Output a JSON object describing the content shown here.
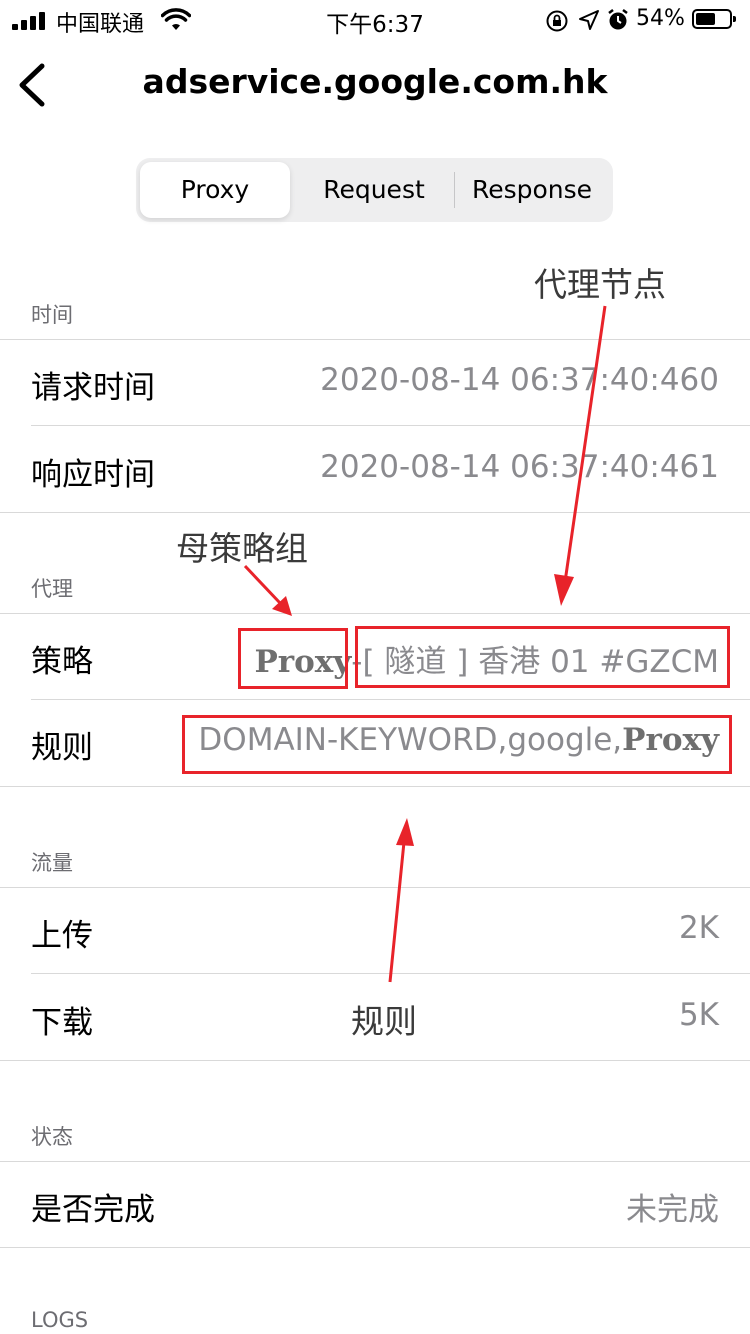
{
  "status_bar": {
    "carrier": "中国联通",
    "time": "下午6:37",
    "battery": "54%"
  },
  "nav": {
    "title": "adservice.google.com.hk"
  },
  "tabs": [
    {
      "label": "Proxy",
      "active": true
    },
    {
      "label": "Request",
      "active": false
    },
    {
      "label": "Response",
      "active": false
    }
  ],
  "sections": {
    "time": {
      "header": "时间",
      "rows": [
        {
          "label": "请求时间",
          "value": "2020-08-14 06:37:40:460"
        },
        {
          "label": "响应时间",
          "value": "2020-08-14 06:37:40:461"
        }
      ]
    },
    "proxy": {
      "header": "代理",
      "policy_label": "策略",
      "policy_group": "Proxy",
      "policy_separator": "-",
      "policy_node": "[ 隧道 ] 香港 01 #GZCM",
      "rule_label": "规则",
      "rule_text": "DOMAIN-KEYWORD,google,",
      "rule_policy": "Proxy"
    },
    "traffic": {
      "header": "流量",
      "rows": [
        {
          "label": "上传",
          "value": "2K"
        },
        {
          "label": "下载",
          "value": "5K"
        }
      ]
    },
    "state": {
      "header": "状态",
      "rows": [
        {
          "label": "是否完成",
          "value": "未完成"
        }
      ]
    },
    "logs": {
      "header": "LOGS"
    }
  },
  "annotations": {
    "proxy_node": "代理节点",
    "parent_group": "母策略组",
    "rule": "规则",
    "color": "#e8232a"
  }
}
